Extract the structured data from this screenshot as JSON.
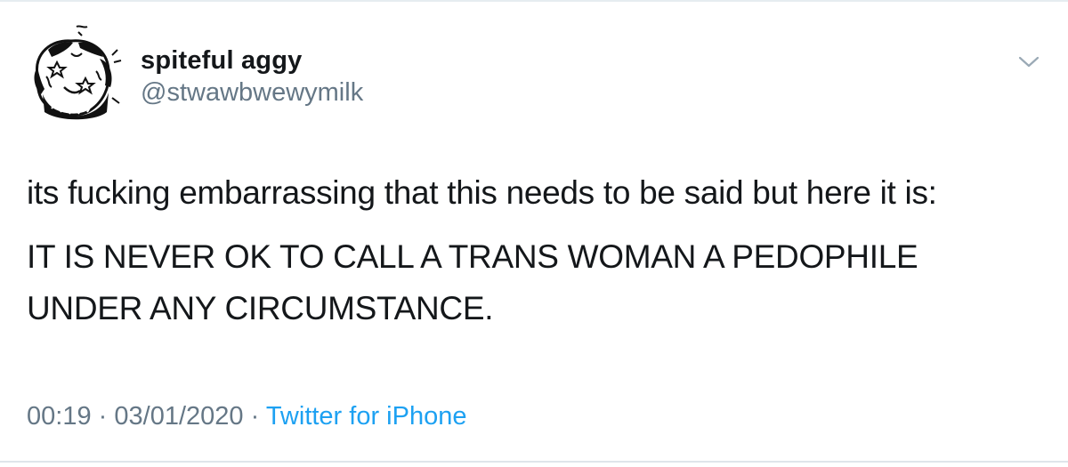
{
  "tweet": {
    "author": {
      "display_name": "spiteful aggy",
      "handle": "@stwawbwewymilk",
      "avatar_icon": "cartoon-avatar-icon"
    },
    "menu_icon": "chevron-down-icon",
    "text_lines": [
      "its fucking embarrassing that this needs to be said but here it is:",
      "IT IS NEVER OK TO CALL A TRANS WOMAN A PEDOPHILE",
      "UNDER ANY CIRCUMSTANCE."
    ],
    "time": "00:19",
    "separator": "·",
    "date": "03/01/2020",
    "source": "Twitter for iPhone"
  },
  "colors": {
    "text": "#14171a",
    "secondary": "#657786",
    "link": "#1da1f2",
    "divider": "#e6ecf0"
  }
}
